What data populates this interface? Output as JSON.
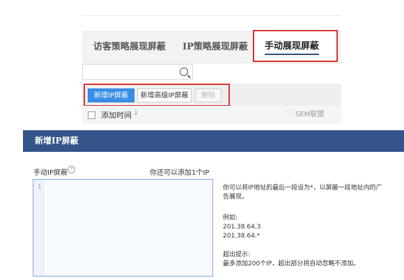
{
  "tabs": [
    {
      "label": "访客策略展现屏蔽"
    },
    {
      "label": "IP策略展现屏蔽"
    },
    {
      "label": "手动展现屏蔽"
    }
  ],
  "search": {
    "placeholder": ""
  },
  "toolbar": {
    "add_ip": "新增IP屏蔽",
    "add_advanced_ip": "新增高级IP屏蔽",
    "delete": "删除"
  },
  "table": {
    "col_added_time": "添加时间",
    "sort_glyph": "↓",
    "watermark": "SEM联盟"
  },
  "dialog": {
    "title": "新增IP屏蔽",
    "manual_label": "手动IP屏蔽",
    "remaining": "你还可以添加1个IP",
    "line_number": "1",
    "hint_text": "你可以将IP地址的最后一段设为*，以屏蔽一段地址内的广告展现。",
    "example_title": "例如:",
    "example1": "201.38.64.3",
    "example2": "201.38.64.*",
    "limit_title": "超出提示:",
    "limit_text": "最多添加200个IP，超出部分将自动忽略不添加。"
  },
  "colors": {
    "primary": "#3b8ee8",
    "header": "#34548a",
    "highlight": "#d9322e"
  }
}
